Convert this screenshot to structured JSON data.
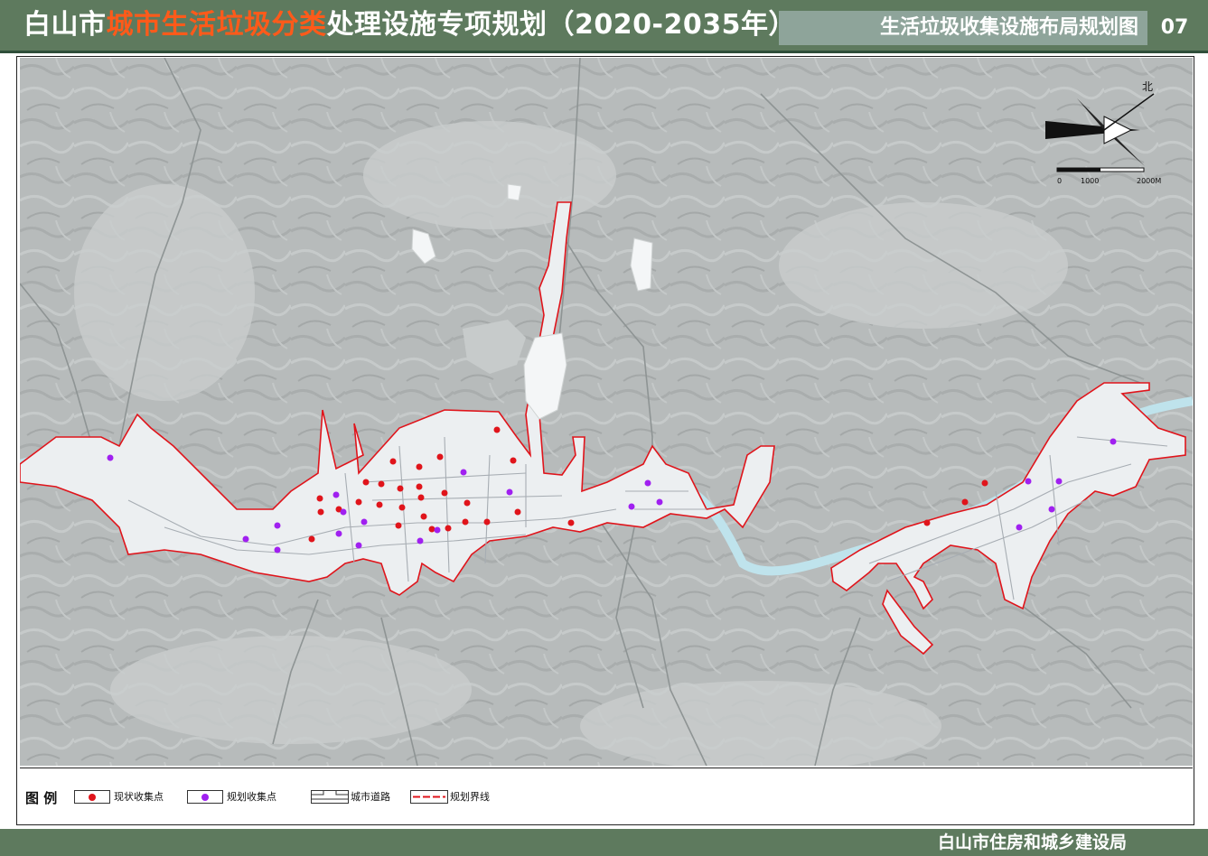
{
  "header": {
    "title_part1": "白山市",
    "title_highlight": "城市生活垃圾分类",
    "title_part2": "处理设施专项规划（2020-2035年）",
    "subtitle": "生活垃圾收集设施布局规划图",
    "page_number": "07"
  },
  "map": {
    "north_label": "北",
    "scale_labels": [
      "0",
      "1000",
      "2000M"
    ],
    "colors": {
      "terrain": "#b9bdbd",
      "urban": "#eef0f2",
      "river": "#bfe3ec",
      "boundary": "#e0141b",
      "existing_point": "#e0141b",
      "planned_point": "#a020f0"
    }
  },
  "legend": {
    "title": "图  例",
    "items": [
      {
        "label": "现状收集点",
        "symbol": "red-dot-icon"
      },
      {
        "label": "规划收集点",
        "symbol": "purple-dot-icon"
      },
      {
        "label": "城市道路",
        "symbol": "road-icon"
      },
      {
        "label": "规划界线",
        "symbol": "boundary-line-icon"
      }
    ]
  },
  "footer": {
    "issuer": "白山市住房和城乡建设局"
  }
}
